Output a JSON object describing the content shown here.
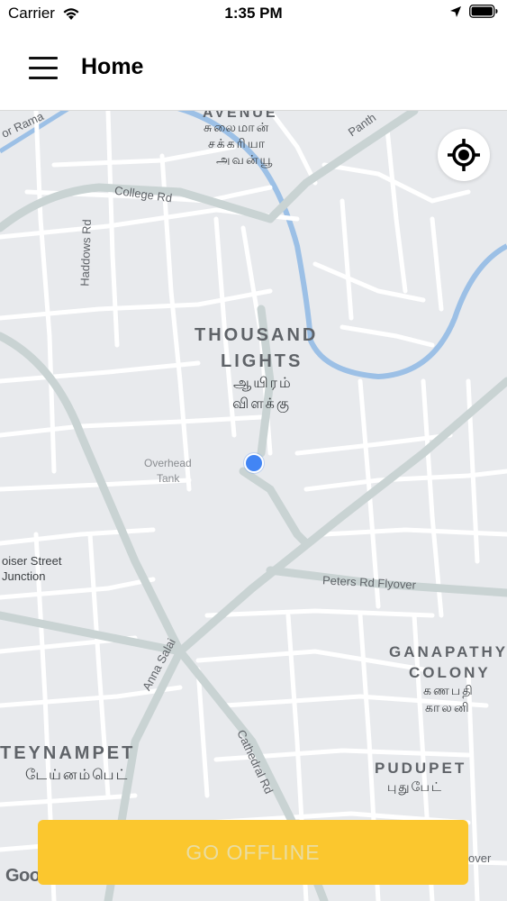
{
  "status_bar": {
    "carrier": "Carrier",
    "time": "1:35 PM",
    "icons": [
      "wifi-icon",
      "location-arrow-icon",
      "battery-icon"
    ]
  },
  "nav": {
    "menu_icon": "hamburger-menu-icon",
    "title": "Home"
  },
  "map": {
    "labels": {
      "avenue": "AVENUE",
      "avenue_tamil_1": "சுலைமான்",
      "avenue_tamil_2": "சக்கரியா",
      "avenue_tamil_3": "அவன்யூ",
      "or_rama": "or Rama",
      "panth": "Panth",
      "college_rd": "College Rd",
      "haddows_rd": "Haddows Rd",
      "thousand_lights_1": "THOUSAND",
      "thousand_lights_2": "LIGHTS",
      "thousand_lights_tamil_1": "ஆயிரம்",
      "thousand_lights_tamil_2": "விளக்கு",
      "overhead_tank_1": "Overhead",
      "overhead_tank_2": "Tank",
      "boiser_street_1": "oiser Street",
      "boiser_street_2": "Junction",
      "peters_rd": "Peters Rd Flyover",
      "anna_salai": "Anna Salai",
      "ganapathy_1": "GANAPATHY",
      "ganapathy_2": "COLONY",
      "ganapathy_tamil_1": "கணபதி",
      "ganapathy_tamil_2": "காலனி",
      "teynampet": "TEYNAMPET",
      "teynampet_tamil": "டேய்னம்பெட்",
      "cathedral_rd": "Cathedral Rd",
      "pudupet": "PUDUPET",
      "pudupet_tamil": "புதுபேட்",
      "over": "over",
      "google": "Google"
    },
    "locate_button_icon": "my-location-icon",
    "colors": {
      "land": "#e8eaed",
      "road": "#ffffff",
      "arterial": "#c9d3d3",
      "water": "#9cc0e6",
      "user_dot": "#4285f4"
    }
  },
  "action": {
    "offline_label": "GO OFFLINE",
    "color": "#fbc72e"
  }
}
